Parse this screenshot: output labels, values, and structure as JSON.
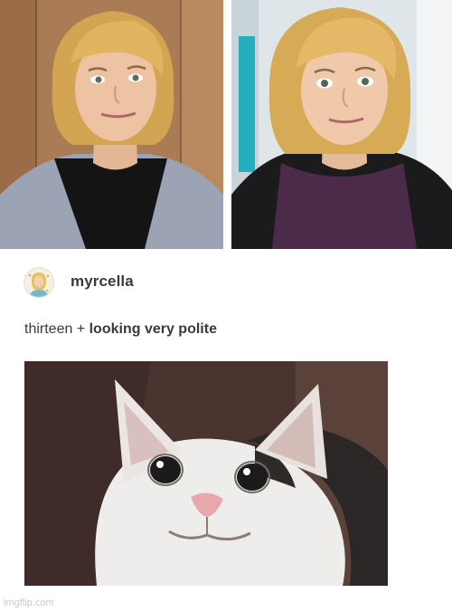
{
  "post": {
    "username": "myrcella",
    "caption_plain": "thirteen + ",
    "caption_bold": "looking very polite"
  },
  "images": {
    "top_left": "photo-woman-blonde-bob-polite-smile",
    "top_right": "photo-woman-blonde-bob-polite-smile-purple-shirt",
    "bottom": "photo-polite-cat-smile",
    "avatar": "avatar-illustration"
  },
  "watermark": "imgflip.com",
  "colors": {
    "text": "#3a3a3a",
    "hair": "#d9b05c",
    "cat_white": "#f1efed",
    "cat_black": "#2b2726",
    "cat_background": "#4a3430"
  }
}
